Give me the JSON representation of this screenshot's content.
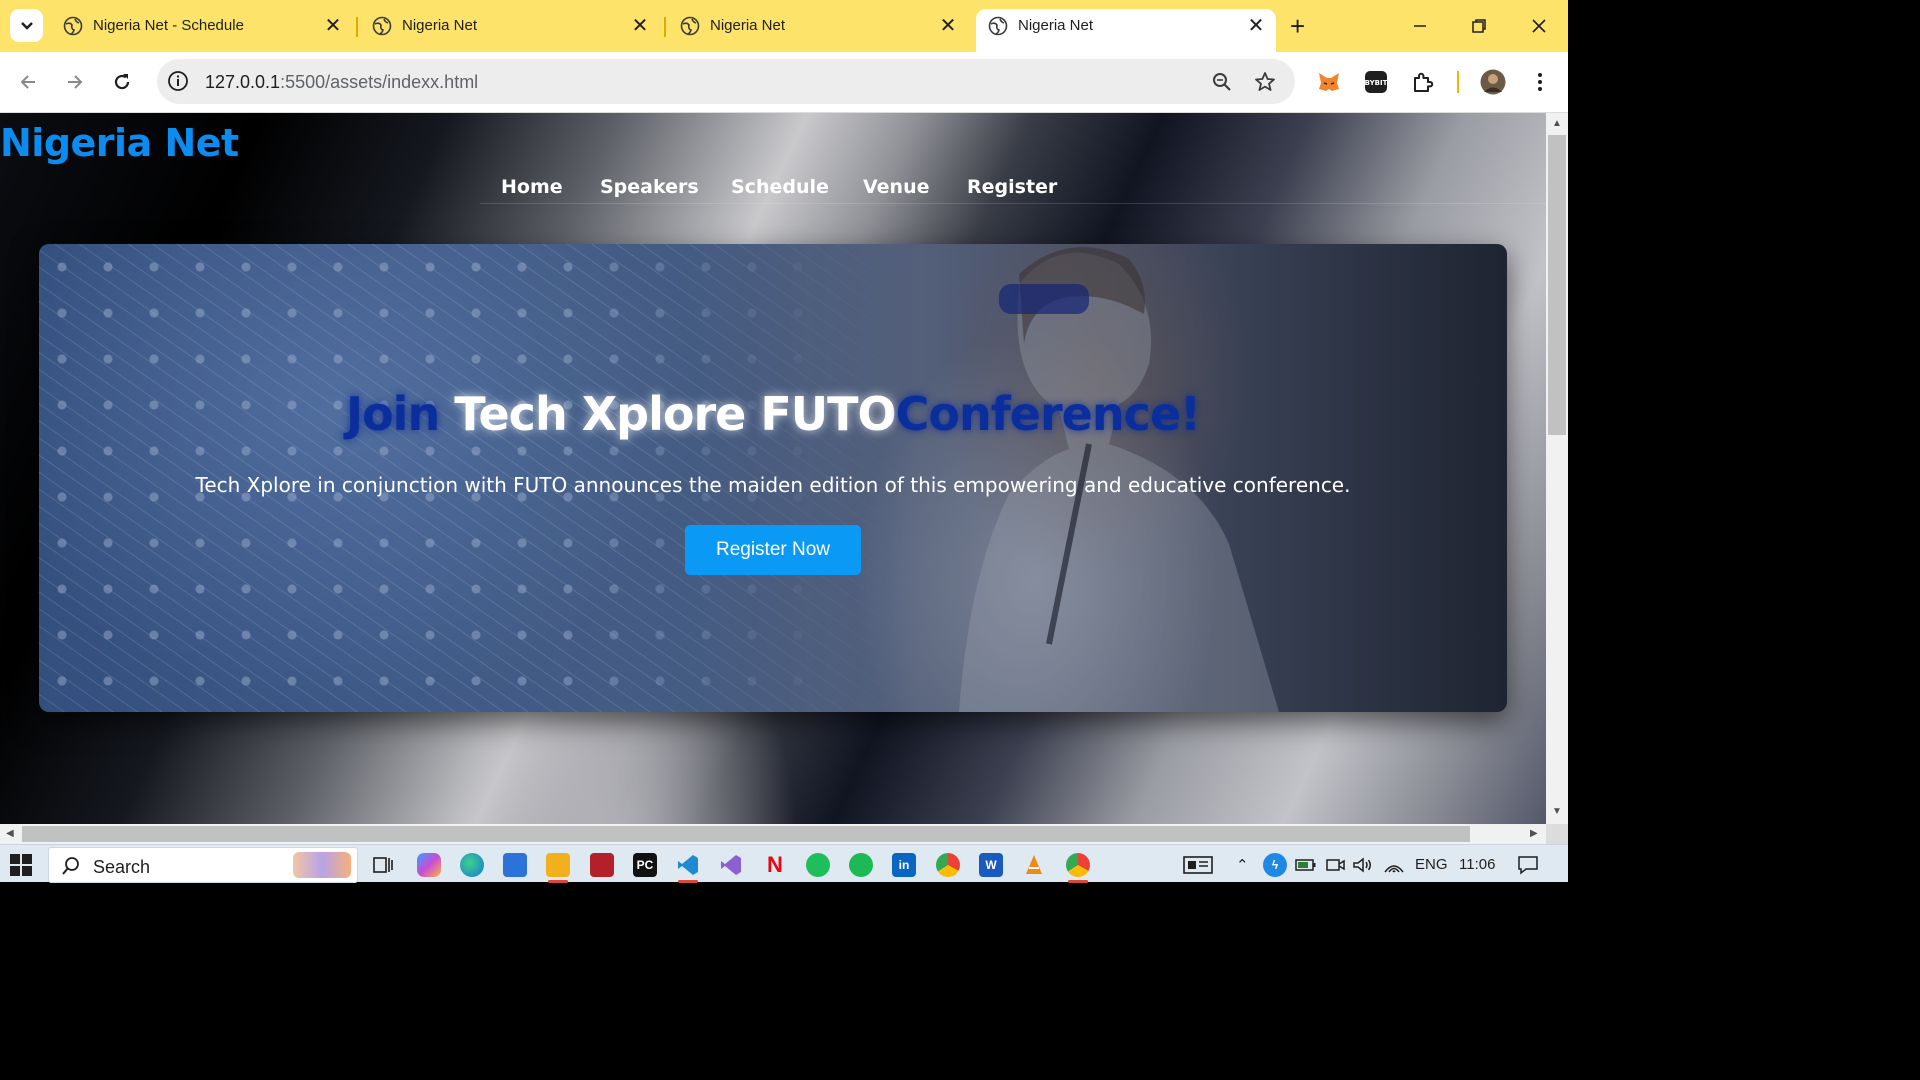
{
  "tabs": [
    {
      "title": "Nigeria Net - Schedule",
      "active": false
    },
    {
      "title": "Nigeria Net",
      "active": false
    },
    {
      "title": "Nigeria Net",
      "active": false
    },
    {
      "title": "Nigeria Net",
      "active": true
    }
  ],
  "address_bar": {
    "host": "127.0.0.1",
    "path": ":5500/assets/indexx.html"
  },
  "page": {
    "brand": "Nigeria Net",
    "nav": [
      "Home",
      "Speakers",
      "Schedule",
      "Venue",
      "Register"
    ],
    "hero": {
      "title_part1": "Join ",
      "title_part2": "Tech Xplore FUTO",
      "title_part3": "Conference!",
      "subtitle": "Tech Xplore in conjunction with FUTO announces the maiden edition of this empowering and educative conference.",
      "cta": "Register Now"
    }
  },
  "taskbar": {
    "search_label": "Search",
    "language": "ENG",
    "time": "11:06"
  },
  "colors": {
    "tab_strip": "#fde36a",
    "brand": "#0b8cf0",
    "cta": "#0a9af5",
    "hero_title_accent": "#0a2f9c"
  }
}
